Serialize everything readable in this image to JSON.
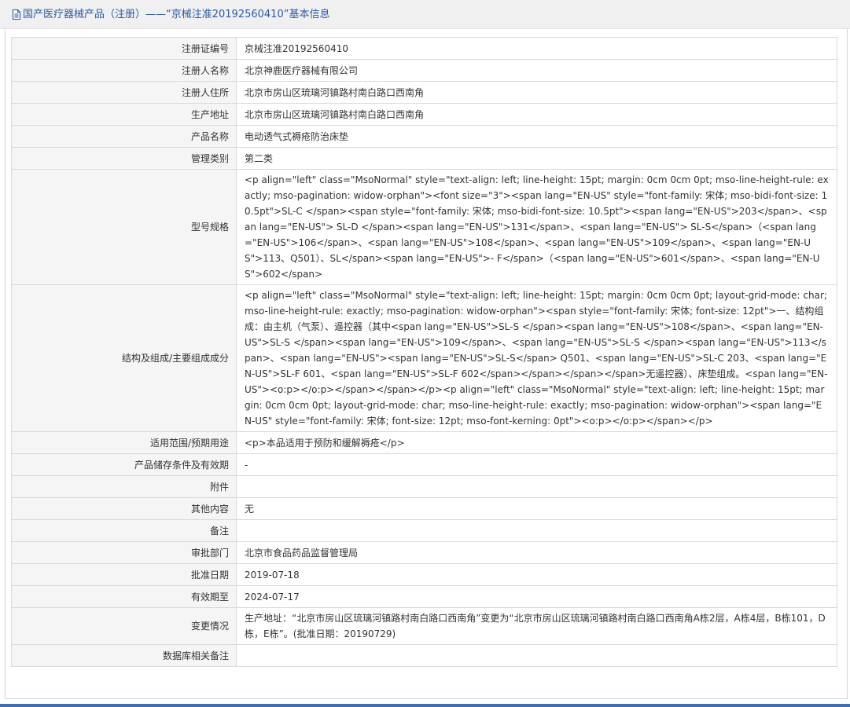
{
  "header": {
    "title": "国产医疗器械产品（注册）——“京械注准20192560410”基本信息",
    "icon": "document-icon",
    "title_color": "#2a5aa8"
  },
  "rows": [
    {
      "label": "注册证编号",
      "value": "京械注准20192560410"
    },
    {
      "label": "注册人名称",
      "value": "北京神鹿医疗器械有限公司"
    },
    {
      "label": "注册人住所",
      "value": "北京市房山区琉璃河镇路村南白路口西南角"
    },
    {
      "label": "生产地址",
      "value": "北京市房山区琉璃河镇路村南白路口西南角"
    },
    {
      "label": "产品名称",
      "value": "电动透气式褥疮防治床垫"
    },
    {
      "label": "管理类别",
      "value": "第二类"
    },
    {
      "label": "型号规格",
      "value": "<p align=\"left\" class=\"MsoNormal\" style=\"text-align: left; line-height: 15pt; margin: 0cm 0cm 0pt; mso-line-height-rule: exactly; mso-pagination: widow-orphan\"><font size=\"3\"><span lang=\"EN-US\" style=\"font-family: 宋体; mso-bidi-font-size: 10.5pt\">SL-C </span><span style=\"font-family: 宋体; mso-bidi-font-size: 10.5pt\"><span lang=\"EN-US\">203</span>、<span lang=\"EN-US\"> SL-D </span><span lang=\"EN-US\">131</span>、<span lang=\"EN-US\"> SL-S</span>（<span lang=\"EN-US\">106</span>、<span lang=\"EN-US\">108</span>、<span lang=\"EN-US\">109</span>、<span lang=\"EN-US\">113、Q501）、SL</span><span lang=\"EN-US\">- F</span>（<span lang=\"EN-US\">601</span>、<span lang=\"EN-US\">602</span>"
    },
    {
      "label": "结构及组成/主要组成成分",
      "value": "<p align=\"left\" class=\"MsoNormal\" style=\"text-align: left; line-height: 15pt; margin: 0cm 0cm 0pt; layout-grid-mode: char; mso-line-height-rule: exactly; mso-pagination: widow-orphan\"><span style=\"font-family: 宋体; font-size: 12pt\">一、结构组成：由主机（气泵）、遥控器（其中<span lang=\"EN-US\">SL-S </span><span lang=\"EN-US\">108</span>、<span lang=\"EN-US\">SL-S </span><span lang=\"EN-US\">109</span>、<span lang=\"EN-US\">SL-S </span><span lang=\"EN-US\">113</span>、<span lang=\"EN-US\"><span lang=\"EN-US\">SL-S</span> Q501、<span lang=\"EN-US\">SL-C 203、<span lang=\"EN-US\">SL-F 601、<span lang=\"EN-US\">SL-F 602</span></span></span></span>无遥控器）、床垫组成。<span lang=\"EN-US\"><o:p></o:p></span></span></p><p align=\"left\" class=\"MsoNormal\" style=\"text-align: left; line-height: 15pt; margin: 0cm 0cm 0pt; layout-grid-mode: char; mso-line-height-rule: exactly; mso-pagination: widow-orphan\"><span lang=\"EN-US\" style=\"font-family: 宋体; font-size: 12pt; mso-font-kerning: 0pt\"><o:p></o:p></span></p>"
    },
    {
      "label": "适用范围/预期用途",
      "value": "<p>本品适用于预防和缓解褥疮</p>"
    },
    {
      "label": "产品储存条件及有效期",
      "value": "-"
    },
    {
      "label": "附件",
      "value": ""
    },
    {
      "label": "其他内容",
      "value": "无"
    },
    {
      "label": "备注",
      "value": ""
    },
    {
      "label": "审批部门",
      "value": "北京市食品药品监督管理局"
    },
    {
      "label": "批准日期",
      "value": "2019-07-18"
    },
    {
      "label": "有效期至",
      "value": "2024-07-17"
    },
    {
      "label": "变更情况",
      "value": "生产地址：“北京市房山区琉璃河镇路村南白路口西南角”变更为“北京市房山区琉璃河镇路村南白路口西南角A栋2层，A栋4层，B栋101，D栋，E栋”。(批准日期：20190729)"
    },
    {
      "label": "数据库相关备注",
      "value": ""
    }
  ],
  "colors": {
    "label_bg": "#f5f5f5",
    "border": "#d9d9d9",
    "bottom_bar": "#3f6fb3"
  }
}
